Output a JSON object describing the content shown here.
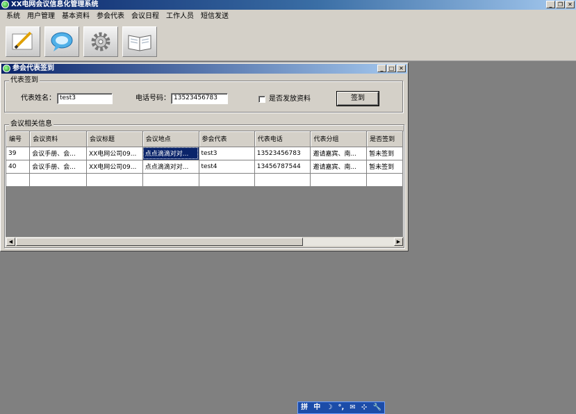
{
  "app": {
    "title": "XX电网会议信息化管理系统"
  },
  "title_buttons": {
    "minimize": "_",
    "restore": "❐",
    "close": "✕"
  },
  "menu": [
    "系统",
    "用户管理",
    "基本资料",
    "参会代表",
    "会议日程",
    "工作人员",
    "短信发送"
  ],
  "toolbar": {
    "buttons": [
      {
        "icon": "pencil-icon"
      },
      {
        "icon": "chat-bubble-icon"
      },
      {
        "icon": "gear-icon"
      },
      {
        "icon": "open-book-icon"
      }
    ]
  },
  "signin_window": {
    "title": "参会代表签到",
    "group1": {
      "legend": "代表签到",
      "name_label": "代表姓名：",
      "name_value": "test3",
      "phone_label": "电话号码：",
      "phone_value": "13523456783",
      "checkbox_label": "是否发放资料",
      "checkbox_checked": false,
      "signin_button": "签到"
    },
    "group2": {
      "legend": "会议相关信息",
      "columns": [
        "编号",
        "会议资料",
        "会议标题",
        "会议地点",
        "参会代表",
        "代表电话",
        "代表分组",
        "是否签到"
      ],
      "rows": [
        [
          "39",
          "会议手册、会...",
          "XX电网公司09...",
          "点点滴滴对对...",
          "test3",
          "13523456783",
          "邀请嘉宾、南...",
          "暂未签到"
        ],
        [
          "40",
          "会议手册、会...",
          "XX电网公司09...",
          "点点滴滴对对...",
          "test4",
          "13456787544",
          "邀请嘉宾、南...",
          "暂未签到"
        ],
        [
          "",
          "",
          "",
          "",
          "",
          "",
          "",
          ""
        ]
      ],
      "selected_cell": {
        "row": 0,
        "col": 3
      }
    }
  },
  "ime_bar": {
    "items": [
      "拼",
      "中",
      "☽",
      "°,",
      "✉",
      "⊹",
      "🔧"
    ]
  },
  "colors": {
    "titlebar": "#0a246a",
    "face": "#d4d0c8",
    "desktop": "#808080",
    "selection": "#0a246a"
  }
}
